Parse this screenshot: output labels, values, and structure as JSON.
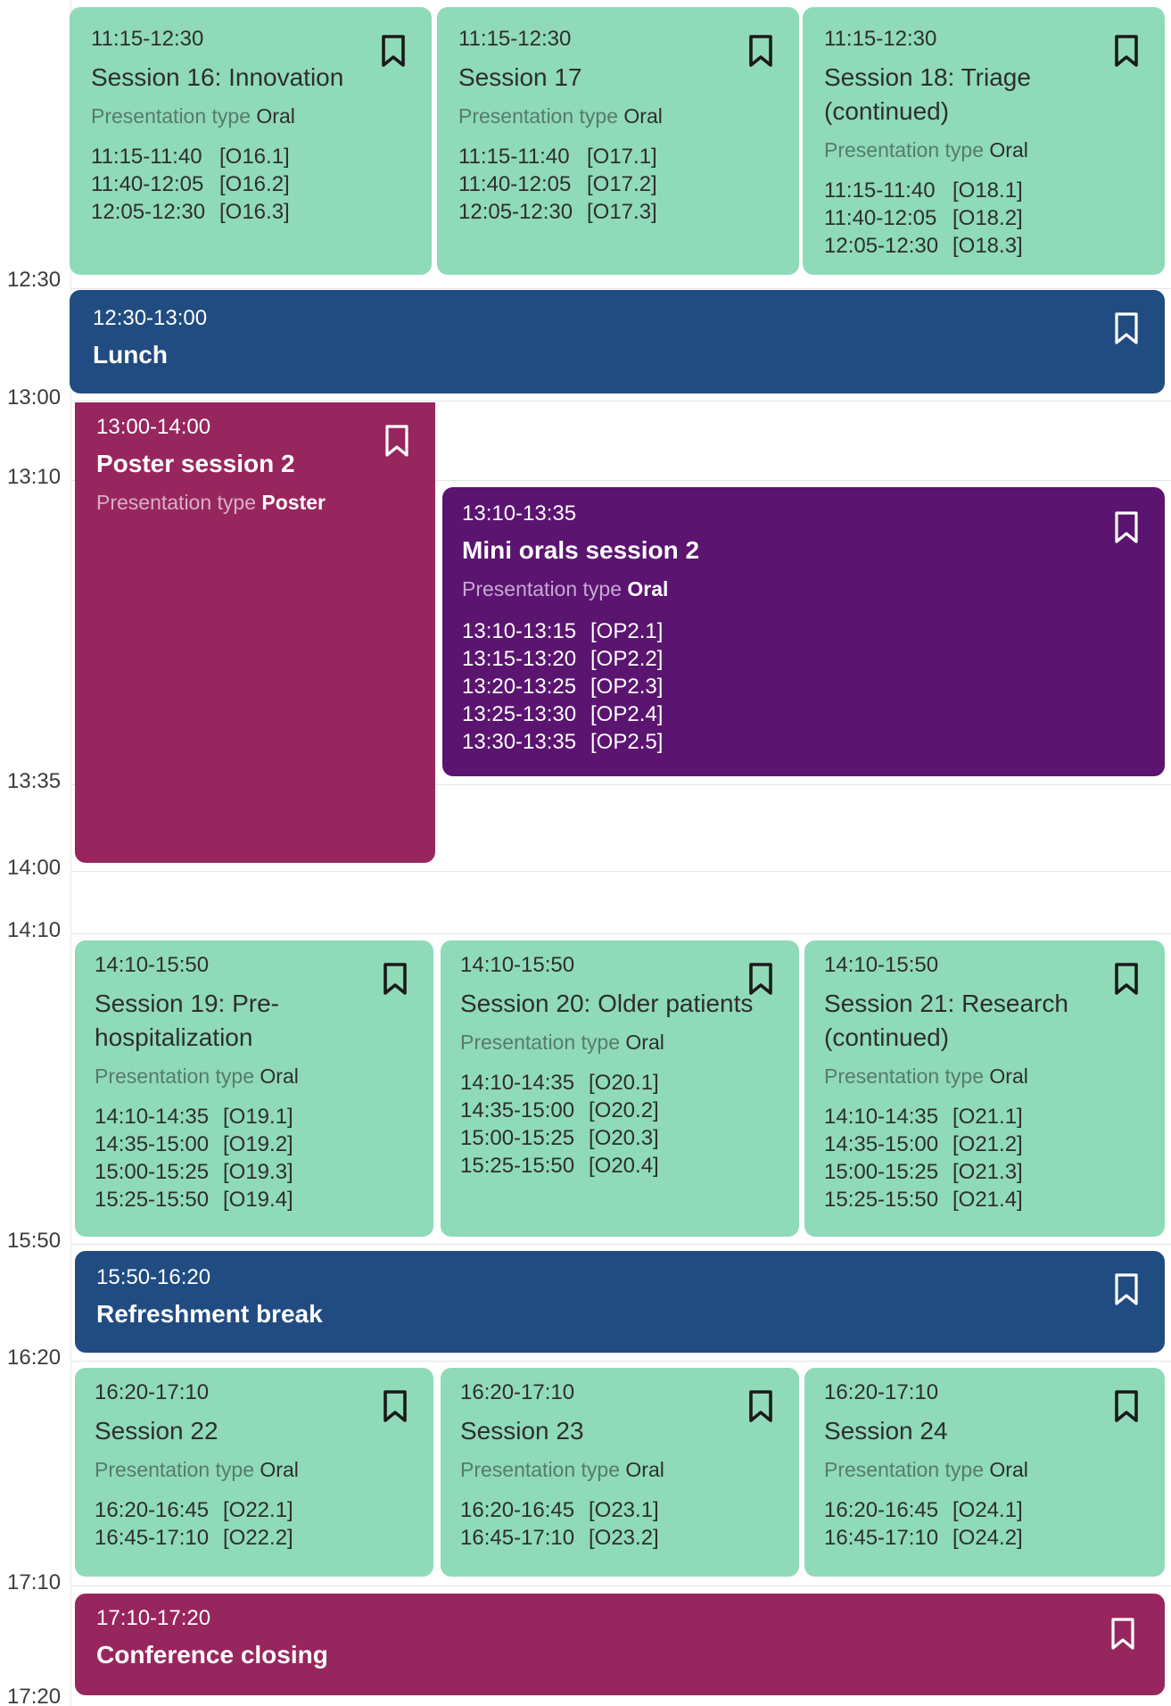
{
  "time_labels": [
    "12:30",
    "13:00",
    "13:10",
    "13:35",
    "14:00",
    "14:10",
    "15:50",
    "16:20",
    "17:10",
    "17:20"
  ],
  "presentation_type_label": "Presentation type",
  "icons": {
    "bookmark": "bookmark-icon"
  },
  "colors": {
    "oral": "#8fdab9",
    "break": "#214c81",
    "poster": "#98265e",
    "mini_orals": "#5b1470"
  },
  "sessions": [
    {
      "time": "11:15-12:30",
      "title": "Session 16: Innovation",
      "type": "Oral",
      "talks": [
        {
          "time": "11:15-11:40",
          "code": "[O16.1]"
        },
        {
          "time": "11:40-12:05",
          "code": "[O16.2]"
        },
        {
          "time": "12:05-12:30",
          "code": "[O16.3]"
        }
      ]
    },
    {
      "time": "11:15-12:30",
      "title": "Session 17",
      "type": "Oral",
      "talks": [
        {
          "time": "11:15-11:40",
          "code": "[O17.1]"
        },
        {
          "time": "11:40-12:05",
          "code": "[O17.2]"
        },
        {
          "time": "12:05-12:30",
          "code": "[O17.3]"
        }
      ]
    },
    {
      "time": "11:15-12:30",
      "title": "Session 18: Triage (continued)",
      "type": "Oral",
      "talks": [
        {
          "time": "11:15-11:40",
          "code": "[O18.1]"
        },
        {
          "time": "11:40-12:05",
          "code": "[O18.2]"
        },
        {
          "time": "12:05-12:30",
          "code": "[O18.3]"
        }
      ]
    },
    {
      "time": "12:30-13:00",
      "title": "Lunch"
    },
    {
      "time": "13:00-14:00",
      "title": "Poster session 2",
      "type": "Poster"
    },
    {
      "time": "13:10-13:35",
      "title": "Mini orals session 2",
      "type": "Oral",
      "talks": [
        {
          "time": "13:10-13:15",
          "code": "[OP2.1]"
        },
        {
          "time": "13:15-13:20",
          "code": "[OP2.2]"
        },
        {
          "time": "13:20-13:25",
          "code": "[OP2.3]"
        },
        {
          "time": "13:25-13:30",
          "code": "[OP2.4]"
        },
        {
          "time": "13:30-13:35",
          "code": "[OP2.5]"
        }
      ]
    },
    {
      "time": "14:10-15:50",
      "title": "Session 19: Pre-hospitalization",
      "type": "Oral",
      "talks": [
        {
          "time": "14:10-14:35",
          "code": "[O19.1]"
        },
        {
          "time": "14:35-15:00",
          "code": "[O19.2]"
        },
        {
          "time": "15:00-15:25",
          "code": "[O19.3]"
        },
        {
          "time": "15:25-15:50",
          "code": "[O19.4]"
        }
      ]
    },
    {
      "time": "14:10-15:50",
      "title": "Session 20: Older patients",
      "type": "Oral",
      "talks": [
        {
          "time": "14:10-14:35",
          "code": "[O20.1]"
        },
        {
          "time": "14:35-15:00",
          "code": "[O20.2]"
        },
        {
          "time": "15:00-15:25",
          "code": "[O20.3]"
        },
        {
          "time": "15:25-15:50",
          "code": "[O20.4]"
        }
      ]
    },
    {
      "time": "14:10-15:50",
      "title": "Session 21: Research (continued)",
      "type": "Oral",
      "talks": [
        {
          "time": "14:10-14:35",
          "code": "[O21.1]"
        },
        {
          "time": "14:35-15:00",
          "code": "[O21.2]"
        },
        {
          "time": "15:00-15:25",
          "code": "[O21.3]"
        },
        {
          "time": "15:25-15:50",
          "code": "[O21.4]"
        }
      ]
    },
    {
      "time": "15:50-16:20",
      "title": "Refreshment break"
    },
    {
      "time": "16:20-17:10",
      "title": "Session 22",
      "type": "Oral",
      "talks": [
        {
          "time": "16:20-16:45",
          "code": "[O22.1]"
        },
        {
          "time": "16:45-17:10",
          "code": "[O22.2]"
        }
      ]
    },
    {
      "time": "16:20-17:10",
      "title": "Session 23",
      "type": "Oral",
      "talks": [
        {
          "time": "16:20-16:45",
          "code": "[O23.1]"
        },
        {
          "time": "16:45-17:10",
          "code": "[O23.2]"
        }
      ]
    },
    {
      "time": "16:20-17:10",
      "title": "Session 24",
      "type": "Oral",
      "talks": [
        {
          "time": "16:20-16:45",
          "code": "[O24.1]"
        },
        {
          "time": "16:45-17:10",
          "code": "[O24.2]"
        }
      ]
    },
    {
      "time": "17:10-17:20",
      "title": "Conference closing"
    }
  ]
}
